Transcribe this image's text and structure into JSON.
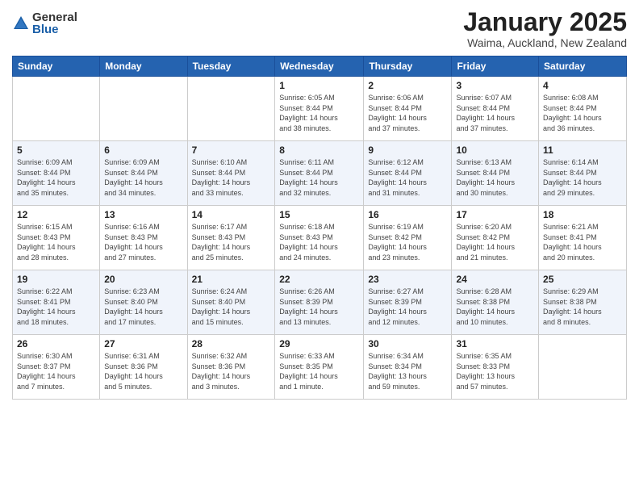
{
  "logo": {
    "general": "General",
    "blue": "Blue"
  },
  "header": {
    "title": "January 2025",
    "location": "Waima, Auckland, New Zealand"
  },
  "weekdays": [
    "Sunday",
    "Monday",
    "Tuesday",
    "Wednesday",
    "Thursday",
    "Friday",
    "Saturday"
  ],
  "weeks": [
    [
      {
        "day": "",
        "info": ""
      },
      {
        "day": "",
        "info": ""
      },
      {
        "day": "",
        "info": ""
      },
      {
        "day": "1",
        "info": "Sunrise: 6:05 AM\nSunset: 8:44 PM\nDaylight: 14 hours\nand 38 minutes."
      },
      {
        "day": "2",
        "info": "Sunrise: 6:06 AM\nSunset: 8:44 PM\nDaylight: 14 hours\nand 37 minutes."
      },
      {
        "day": "3",
        "info": "Sunrise: 6:07 AM\nSunset: 8:44 PM\nDaylight: 14 hours\nand 37 minutes."
      },
      {
        "day": "4",
        "info": "Sunrise: 6:08 AM\nSunset: 8:44 PM\nDaylight: 14 hours\nand 36 minutes."
      }
    ],
    [
      {
        "day": "5",
        "info": "Sunrise: 6:09 AM\nSunset: 8:44 PM\nDaylight: 14 hours\nand 35 minutes."
      },
      {
        "day": "6",
        "info": "Sunrise: 6:09 AM\nSunset: 8:44 PM\nDaylight: 14 hours\nand 34 minutes."
      },
      {
        "day": "7",
        "info": "Sunrise: 6:10 AM\nSunset: 8:44 PM\nDaylight: 14 hours\nand 33 minutes."
      },
      {
        "day": "8",
        "info": "Sunrise: 6:11 AM\nSunset: 8:44 PM\nDaylight: 14 hours\nand 32 minutes."
      },
      {
        "day": "9",
        "info": "Sunrise: 6:12 AM\nSunset: 8:44 PM\nDaylight: 14 hours\nand 31 minutes."
      },
      {
        "day": "10",
        "info": "Sunrise: 6:13 AM\nSunset: 8:44 PM\nDaylight: 14 hours\nand 30 minutes."
      },
      {
        "day": "11",
        "info": "Sunrise: 6:14 AM\nSunset: 8:44 PM\nDaylight: 14 hours\nand 29 minutes."
      }
    ],
    [
      {
        "day": "12",
        "info": "Sunrise: 6:15 AM\nSunset: 8:43 PM\nDaylight: 14 hours\nand 28 minutes."
      },
      {
        "day": "13",
        "info": "Sunrise: 6:16 AM\nSunset: 8:43 PM\nDaylight: 14 hours\nand 27 minutes."
      },
      {
        "day": "14",
        "info": "Sunrise: 6:17 AM\nSunset: 8:43 PM\nDaylight: 14 hours\nand 25 minutes."
      },
      {
        "day": "15",
        "info": "Sunrise: 6:18 AM\nSunset: 8:43 PM\nDaylight: 14 hours\nand 24 minutes."
      },
      {
        "day": "16",
        "info": "Sunrise: 6:19 AM\nSunset: 8:42 PM\nDaylight: 14 hours\nand 23 minutes."
      },
      {
        "day": "17",
        "info": "Sunrise: 6:20 AM\nSunset: 8:42 PM\nDaylight: 14 hours\nand 21 minutes."
      },
      {
        "day": "18",
        "info": "Sunrise: 6:21 AM\nSunset: 8:41 PM\nDaylight: 14 hours\nand 20 minutes."
      }
    ],
    [
      {
        "day": "19",
        "info": "Sunrise: 6:22 AM\nSunset: 8:41 PM\nDaylight: 14 hours\nand 18 minutes."
      },
      {
        "day": "20",
        "info": "Sunrise: 6:23 AM\nSunset: 8:40 PM\nDaylight: 14 hours\nand 17 minutes."
      },
      {
        "day": "21",
        "info": "Sunrise: 6:24 AM\nSunset: 8:40 PM\nDaylight: 14 hours\nand 15 minutes."
      },
      {
        "day": "22",
        "info": "Sunrise: 6:26 AM\nSunset: 8:39 PM\nDaylight: 14 hours\nand 13 minutes."
      },
      {
        "day": "23",
        "info": "Sunrise: 6:27 AM\nSunset: 8:39 PM\nDaylight: 14 hours\nand 12 minutes."
      },
      {
        "day": "24",
        "info": "Sunrise: 6:28 AM\nSunset: 8:38 PM\nDaylight: 14 hours\nand 10 minutes."
      },
      {
        "day": "25",
        "info": "Sunrise: 6:29 AM\nSunset: 8:38 PM\nDaylight: 14 hours\nand 8 minutes."
      }
    ],
    [
      {
        "day": "26",
        "info": "Sunrise: 6:30 AM\nSunset: 8:37 PM\nDaylight: 14 hours\nand 7 minutes."
      },
      {
        "day": "27",
        "info": "Sunrise: 6:31 AM\nSunset: 8:36 PM\nDaylight: 14 hours\nand 5 minutes."
      },
      {
        "day": "28",
        "info": "Sunrise: 6:32 AM\nSunset: 8:36 PM\nDaylight: 14 hours\nand 3 minutes."
      },
      {
        "day": "29",
        "info": "Sunrise: 6:33 AM\nSunset: 8:35 PM\nDaylight: 14 hours\nand 1 minute."
      },
      {
        "day": "30",
        "info": "Sunrise: 6:34 AM\nSunset: 8:34 PM\nDaylight: 13 hours\nand 59 minutes."
      },
      {
        "day": "31",
        "info": "Sunrise: 6:35 AM\nSunset: 8:33 PM\nDaylight: 13 hours\nand 57 minutes."
      },
      {
        "day": "",
        "info": ""
      }
    ]
  ]
}
